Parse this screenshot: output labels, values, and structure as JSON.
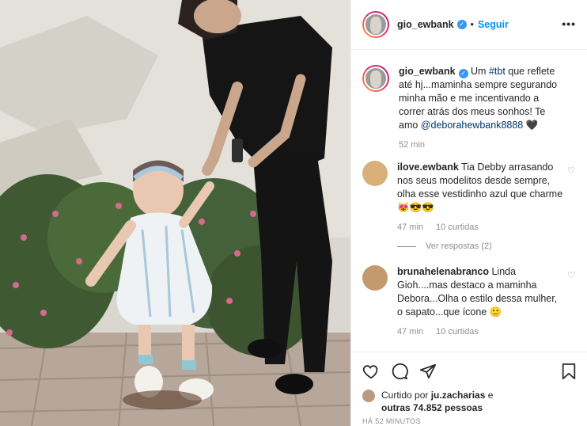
{
  "header": {
    "username": "gio_ewbank",
    "separator": "•",
    "follow_label": "Seguir",
    "more_label": "•••"
  },
  "caption": {
    "username": "gio_ewbank",
    "text_before": " Um ",
    "hashtag": "#tbt",
    "text_after": " que reflete até hj...maminha sempre segurando minha mão e me incentivando a correr atrás dos meus sonhos! Te amo ",
    "mention": "@deborahewbank8888",
    "emoji": " 🖤",
    "time": "52 min"
  },
  "comments": [
    {
      "username": "ilove.ewbank",
      "text": " Tia Debby arrasando nos seus modelitos desde sempre, olha esse vestidinho azul que charme 😻😎😎",
      "time": "47 min",
      "likes": "10 curtidas",
      "replies": "Ver respostas (2)",
      "avatar_color": "#d9b07a"
    },
    {
      "username": "brunahelenabranco",
      "text": " Linda Gioh....mas destaco a maminha Debora...Olha o estilo dessa mulher, o sapato...que ícone 🙂",
      "time": "47 min",
      "likes": "10 curtidas",
      "avatar_color": "#c49a6c"
    }
  ],
  "footer": {
    "liked_prefix": "Curtido por ",
    "liked_user": "ju.zacharias",
    "liked_middle": " e ",
    "liked_others": "outras 74.852 pessoas",
    "timestamp": "HÁ 52 MINUTOS"
  },
  "colors": {
    "accent": "#0095f6",
    "verified": "#3897f0",
    "muted": "#8e8e8e"
  },
  "icons": [
    "heart-icon",
    "comment-icon",
    "share-icon",
    "bookmark-icon",
    "verified-icon",
    "more-options-icon"
  ]
}
